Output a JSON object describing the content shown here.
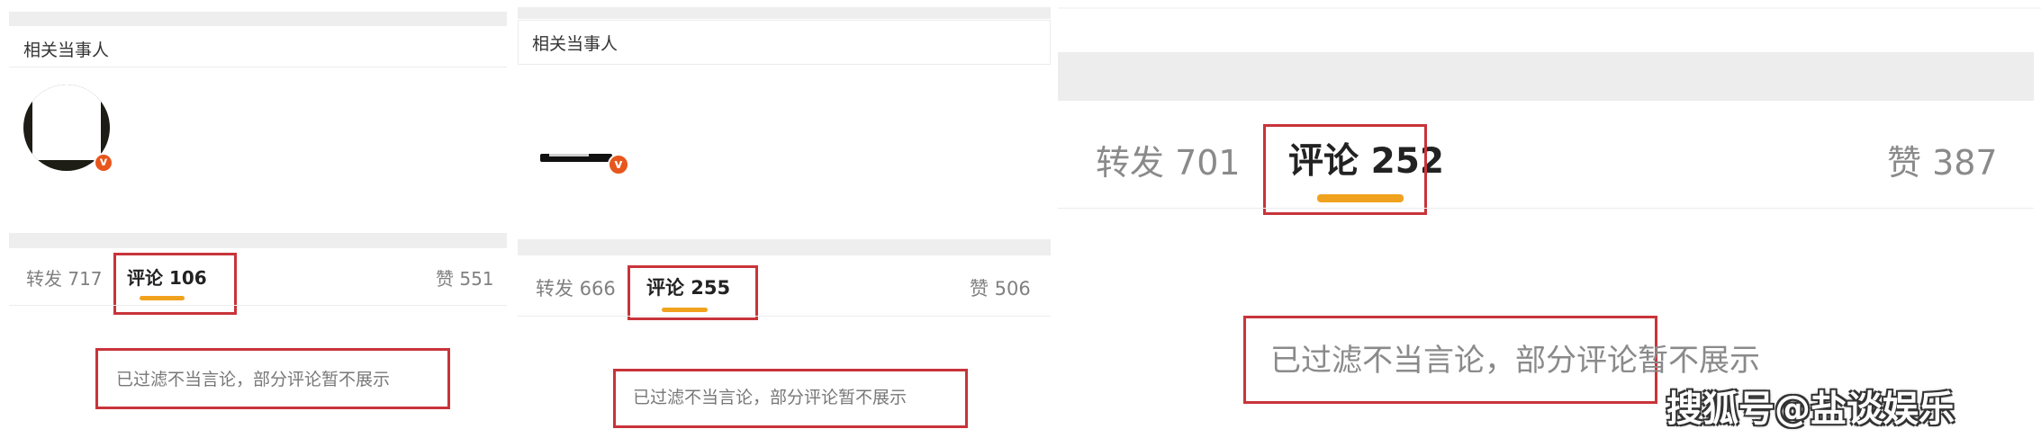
{
  "panels": [
    {
      "section_title": "相关当事人",
      "verified_badge": "v",
      "tabs": {
        "repost": "转发 717",
        "comment": "评论 106",
        "like": "赞 551"
      },
      "filter_notice": "已过滤不当言论，部分评论暂不展示"
    },
    {
      "section_title": "相关当事人",
      "verified_badge": "v",
      "tabs": {
        "repost": "转发 666",
        "comment": "评论 255",
        "like": "赞 506"
      },
      "filter_notice": "已过滤不当言论，部分评论暂不展示"
    },
    {
      "tabs": {
        "repost": "转发 701",
        "comment": "评论 252",
        "like": "赞 387"
      },
      "filter_notice": "已过滤不当言论，部分评论暂不展示"
    }
  ],
  "watermark": "搜狐号@盐谈娱乐",
  "colors": {
    "highlight_box": "#c8343a",
    "active_underline": "#f0a21e",
    "verified_badge": "#e8561c"
  }
}
